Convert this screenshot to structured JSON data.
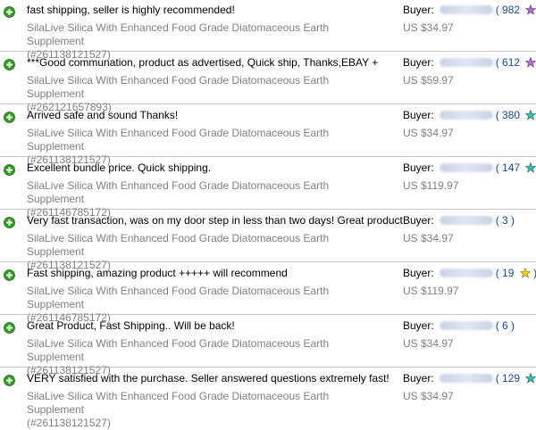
{
  "colors": {
    "purple_star": "#b36bd6",
    "teal_star": "#2fc3b4",
    "yellow_star": "#f2d21a",
    "plus_green": "#2e9e1f"
  },
  "feedback": [
    {
      "comment": "fast shipping, seller is highly recommended!",
      "buyer_label": "Buyer:",
      "score": "982",
      "star": "purple-star",
      "item_line1": "SilaLive Silica With Enhanced Food Grade Diatomaceous Earth Supplement",
      "item_line2": "(#261138121527)",
      "price": "US $34.97"
    },
    {
      "comment": "***Good communation, product as advertised, Quick ship, Thanks,EBAY +",
      "buyer_label": "Buyer:",
      "score": "612",
      "star": "purple-star",
      "item_line1": "SilaLive Silica With Enhanced Food Grade Diatomaceous Earth Supplement",
      "item_line2": "(#262121657893)",
      "price": "US $59.97"
    },
    {
      "comment": "Arrived safe and sound Thanks!",
      "buyer_label": "Buyer:",
      "score": "380",
      "star": "teal-star",
      "item_line1": "SilaLive Silica With Enhanced Food Grade Diatomaceous Earth Supplement",
      "item_line2": "(#261138121527)",
      "price": "US $34.97"
    },
    {
      "comment": "Excellent bundle price. Quick shipping.",
      "buyer_label": "Buyer:",
      "score": "147",
      "star": "teal-star",
      "item_line1": "SilaLive Silica With Enhanced Food Grade Diatomaceous Earth Supplement",
      "item_line2": "(#261146785172)",
      "price": "US $119.97"
    },
    {
      "comment": "Very fast transaction, was on my door step in less than two days! Great product!",
      "buyer_label": "Buyer:",
      "score": "3",
      "star": "",
      "item_line1": "SilaLive Silica With Enhanced Food Grade Diatomaceous Earth Supplement",
      "item_line2": "(#261138121527)",
      "price": "US $34.97"
    },
    {
      "comment": "Fast shipping, amazing product +++++ will recommend",
      "buyer_label": "Buyer:",
      "score": "19",
      "star": "yellow-star",
      "item_line1": "SilaLive Silica With Enhanced Food Grade Diatomaceous Earth Supplement",
      "item_line2": "(#261146785172)",
      "price": "US $119.97"
    },
    {
      "comment": "Great Product, Fast Shipping.. Will be back!",
      "buyer_label": "Buyer:",
      "score": "6",
      "star": "",
      "item_line1": "SilaLive Silica With Enhanced Food Grade Diatomaceous Earth Supplement",
      "item_line2": "(#261138121527)",
      "price": "US $34.97"
    },
    {
      "comment": "VERY satisfied with the purchase. Seller answered questions extremely fast!",
      "buyer_label": "Buyer:",
      "score": "129",
      "star": "teal-star",
      "item_line1": "SilaLive Silica With Enhanced Food Grade Diatomaceous Earth Supplement",
      "item_line2": "(#261138121527)",
      "price": "US $34.97"
    }
  ]
}
